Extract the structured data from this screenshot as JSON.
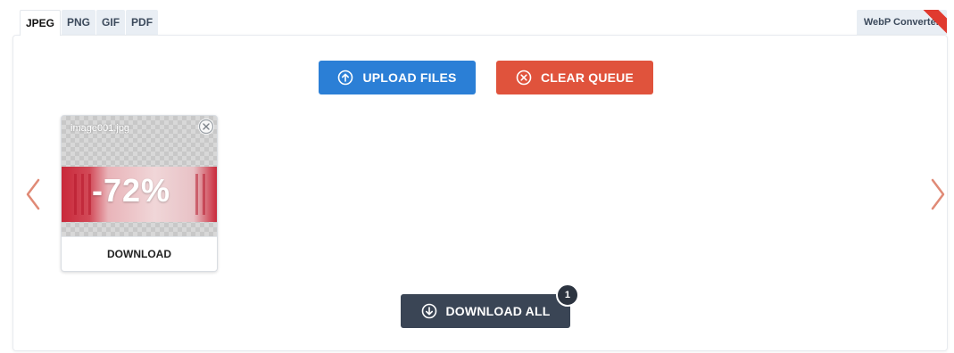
{
  "tabs": [
    {
      "label": "JPEG",
      "active": true
    },
    {
      "label": "PNG",
      "active": false
    },
    {
      "label": "GIF",
      "active": false
    },
    {
      "label": "PDF",
      "active": false
    }
  ],
  "webp_tab": {
    "label": "WebP Converter"
  },
  "toolbar": {
    "upload_label": "UPLOAD FILES",
    "clear_label": "CLEAR QUEUE"
  },
  "files": [
    {
      "name": "image001.jpg",
      "savings": "-72%",
      "download_label": "DOWNLOAD"
    }
  ],
  "download_all": {
    "label": "DOWNLOAD ALL",
    "count": "1"
  },
  "colors": {
    "upload": "#2b7fd6",
    "clear": "#e0533c",
    "download_all": "#3a4555",
    "arrows": "#e08a76",
    "ribbon": "#e03a2f"
  },
  "icons": {
    "upload": "arrow-up-circle-icon",
    "clear": "x-circle-icon",
    "download_all": "arrow-down-circle-icon",
    "prev": "chevron-left-icon",
    "next": "chevron-right-icon",
    "remove": "close-icon"
  }
}
